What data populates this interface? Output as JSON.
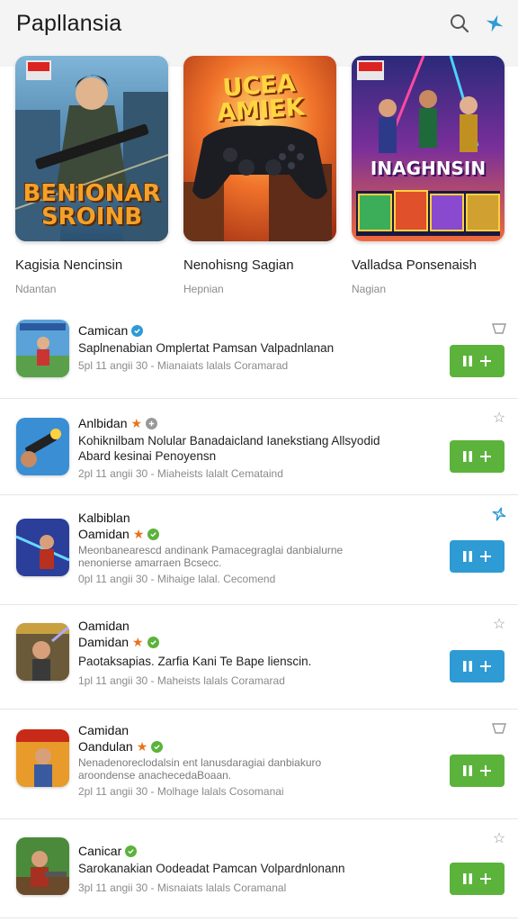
{
  "header": {
    "title": "Papllansia"
  },
  "featured": [
    {
      "name": "Kagisia Nencinsin",
      "category": "Ndantan",
      "art_title": "BENIONAR SROINB",
      "badge": "!"
    },
    {
      "name": "Nenohisng Sagian",
      "category": "Hepnian",
      "art_title": "UCEA AMIEK",
      "badge": ""
    },
    {
      "name": "Valladsa Ponsenaish",
      "category": "Nagian",
      "art_title": "INAGHNSIN",
      "badge": "!"
    }
  ],
  "list": [
    {
      "name": "Camican",
      "name2": "",
      "desc": "Saplnenabian Omplertat Pamsan Valpadnlanan",
      "desc2": "",
      "meta": "5pl 11 angii 30 - Mianaiats lalals Coramarad",
      "badges": [
        "blue"
      ],
      "button": "green",
      "corner": "tray"
    },
    {
      "name": "Anlbidan",
      "name2": "",
      "desc": "Kohiknilbam Nolular Banadaicland Ianekstiang Allsyodid",
      "desc2": "Abard kesinai Penoyensn",
      "meta": "2pl 11 angii 30 - Miaheists lalalt Cemataind",
      "badges": [
        "star",
        "gray"
      ],
      "button": "green",
      "corner": "star"
    },
    {
      "name": "Kalbiblan",
      "name2": "Oamidan",
      "desc": "Meonbanearescd andinank Pamacegraglai danbialurne",
      "desc2": "nenonierse amarraen Bcsecc.",
      "meta": "0pl 11 angii 30 - Mihaige lalal. Cecomend",
      "badges": [
        "star",
        "green"
      ],
      "button": "blue",
      "corner": "starblue",
      "faded": true
    },
    {
      "name": "Oamidan",
      "name2": "Damidan",
      "desc": "Paotaksapias. Zarfia Kani Te Bape lienscin.",
      "desc2": "",
      "meta": "1pl 11 angii 30 - Maheists lalals Coramarad",
      "badges": [
        "star",
        "green"
      ],
      "button": "blue",
      "corner": "star"
    },
    {
      "name": "Camidan",
      "name2": "Oandulan",
      "desc": "Nenadenoreclodalsin ent lanusdaragiai danbiakuro",
      "desc2": "aroondense anachecedaBoaan.",
      "meta": "2pl 11 angii 30 - Molhage lalals Cosomanai",
      "badges": [
        "star",
        "green"
      ],
      "button": "green",
      "corner": "tray",
      "faded": true
    },
    {
      "name": "Canicar",
      "name2": "",
      "desc": "Sarokanakian Oodeadat Pamcan Volpardnlonann",
      "desc2": "",
      "meta": "3pl 11 angii 30 - Misnaiats lalals Coramanal",
      "badges": [
        "green"
      ],
      "button": "green",
      "corner": "star"
    }
  ],
  "colors": {
    "green": "#5bb33b",
    "blue": "#2e9bd4",
    "accent_blue": "#2e9bd4",
    "orange": "#e8731c"
  },
  "icons": {
    "search": "search-icon",
    "sparkle": "sparkle-icon",
    "verified": "verified-icon",
    "star": "star-icon",
    "tray": "tray-icon",
    "pause": "pause-icon",
    "plus": "plus-icon"
  }
}
